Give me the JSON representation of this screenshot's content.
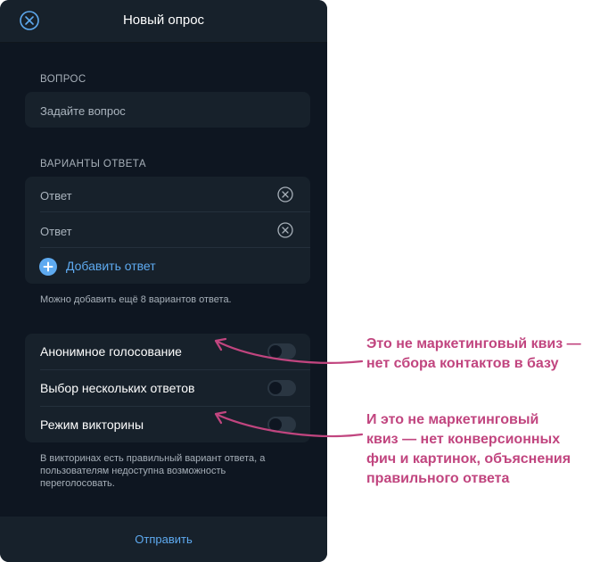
{
  "window": {
    "title": "Новый опрос"
  },
  "question": {
    "section_label": "ВОПРОС",
    "placeholder": "Задайте вопрос"
  },
  "answers": {
    "section_label": "ВАРИАНТЫ ОТВЕТА",
    "options": [
      {
        "placeholder": "Ответ"
      },
      {
        "placeholder": "Ответ"
      }
    ],
    "add_label": "Добавить ответ",
    "hint": "Можно добавить ещё 8 вариантов ответа."
  },
  "settings": {
    "anonymous": {
      "label": "Анонимное голосование",
      "enabled": false
    },
    "multiple": {
      "label": "Выбор нескольких ответов",
      "enabled": false
    },
    "quiz": {
      "label": "Режим викторины",
      "enabled": false
    },
    "hint_lines": [
      "В викторинах есть правильный вариант ответа, а",
      "пользователям недоступна возможность",
      "переголосовать."
    ]
  },
  "footer": {
    "send_label": "Отправить"
  },
  "annotations": [
    {
      "lines": [
        "Это не маркетинговый квиз —",
        "нет сбора контактов в базу"
      ]
    },
    {
      "lines": [
        "И это не маркетинговый",
        "квиз — нет конверсионных",
        "фич и картинок, объяснения",
        "правильного ответа"
      ]
    }
  ],
  "colors": {
    "panel_bg": "#17212b",
    "body_bg": "#0e1621",
    "accent": "#5eaaf0",
    "annotation": "#c1457f"
  }
}
